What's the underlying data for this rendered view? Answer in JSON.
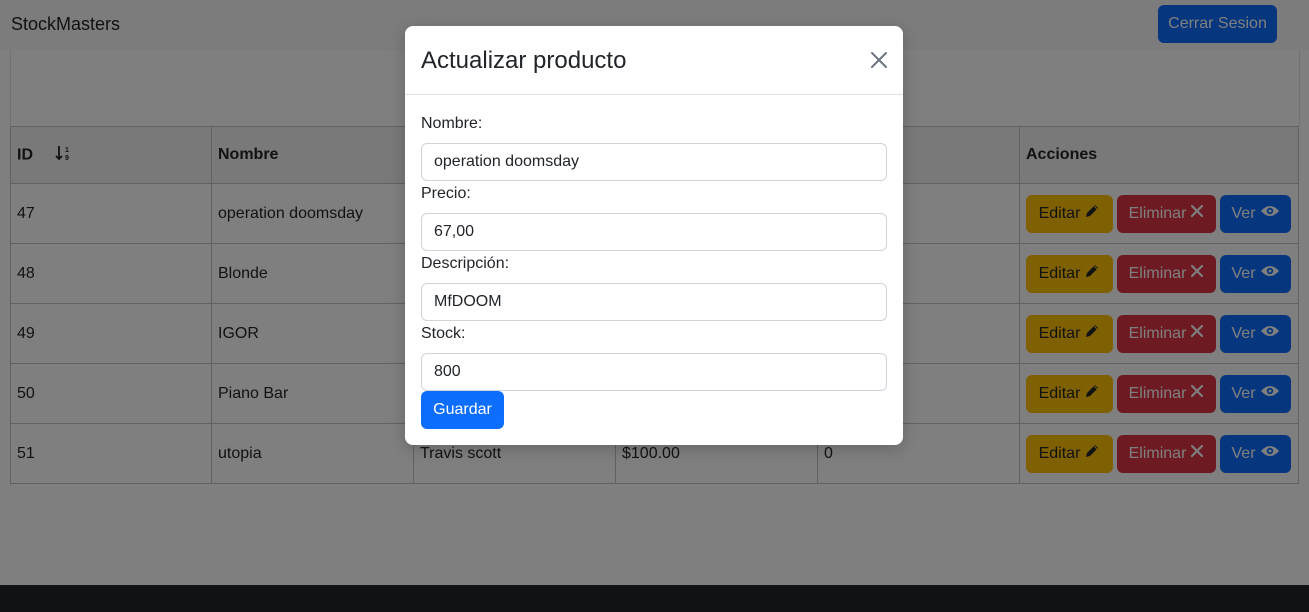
{
  "navbar": {
    "brand": "StockMasters",
    "logout_label": "Cerrar Sesion"
  },
  "table": {
    "headers": {
      "id": "ID",
      "nombre": "Nombre",
      "col3": "",
      "col4": "",
      "col5": "",
      "acciones": "Acciones"
    },
    "rows": [
      {
        "id": "47",
        "nombre": "operation doomsday",
        "artista": "",
        "precio": "",
        "stock": ""
      },
      {
        "id": "48",
        "nombre": "Blonde",
        "artista": "",
        "precio": "",
        "stock": ""
      },
      {
        "id": "49",
        "nombre": "IGOR",
        "artista": "",
        "precio": "",
        "stock": ""
      },
      {
        "id": "50",
        "nombre": "Piano Bar",
        "artista": "",
        "precio": "",
        "stock": ""
      },
      {
        "id": "51",
        "nombre": "utopia",
        "artista": "Travis scott",
        "precio": "$100.00",
        "stock": "0"
      }
    ],
    "actions": {
      "edit": "Editar",
      "delete": "Eliminar",
      "view": "Ver"
    }
  },
  "modal": {
    "title": "Actualizar producto",
    "fields": {
      "nombre": {
        "label": "Nombre:",
        "value": "operation doomsday"
      },
      "precio": {
        "label": "Precio:",
        "value": "67,00"
      },
      "descripcion": {
        "label": "Descripción:",
        "value": "MfDOOM"
      },
      "stock": {
        "label": "Stock:",
        "value": "800"
      }
    },
    "save_label": "Guardar"
  },
  "colors": {
    "primary": "#0d6efd",
    "warning": "#ffc107",
    "danger": "#dc3545",
    "footer": "#212529"
  }
}
